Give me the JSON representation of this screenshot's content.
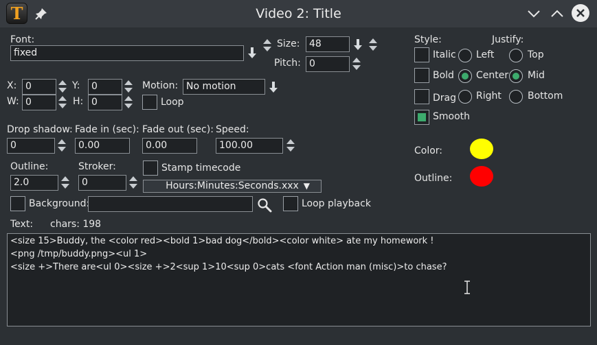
{
  "window": {
    "title": "Video 2: Title"
  },
  "icons": {
    "app": "title-app-icon",
    "pin": "pin-icon",
    "minimize": "chevron-down-icon",
    "maximize": "chevron-up-icon",
    "close": "close-icon"
  },
  "app_icon_letter": "T",
  "font": {
    "label": "Font:",
    "value": "fixed"
  },
  "size": {
    "label": "Size:",
    "value": "48"
  },
  "pitch": {
    "label": "Pitch:",
    "value": "0"
  },
  "position": {
    "x_label": "X:",
    "x_value": "0",
    "y_label": "Y:",
    "y_value": "0",
    "w_label": "W:",
    "w_value": "0",
    "h_label": "H:",
    "h_value": "0"
  },
  "motion": {
    "label": "Motion:",
    "value": "No motion",
    "loop_label": "Loop",
    "loop_checked": false
  },
  "drop_shadow": {
    "label": "Drop shadow:",
    "value": "0"
  },
  "fade_in": {
    "label": "Fade in (sec):",
    "value": "0.00"
  },
  "fade_out": {
    "label": "Fade out (sec):",
    "value": "0.00"
  },
  "speed": {
    "label": "Speed:",
    "value": "100.00"
  },
  "outline": {
    "label": "Outline:",
    "value": "2.0"
  },
  "stroker": {
    "label": "Stroker:",
    "value": "0"
  },
  "stamp_timecode": {
    "label": "Stamp timecode",
    "checked": false
  },
  "timecode_format": {
    "value": "Hours:Minutes:Seconds.xxx",
    "arrow": "▼"
  },
  "background": {
    "label": "Background:",
    "value": "",
    "checked": false
  },
  "loop_playback": {
    "label": "Loop playback",
    "checked": false
  },
  "style": {
    "label": "Style:",
    "italic": {
      "label": "Italic",
      "checked": false
    },
    "bold": {
      "label": "Bold",
      "checked": false
    },
    "drag": {
      "label": "Drag",
      "checked": false
    },
    "smooth": {
      "label": "Smooth",
      "checked": true
    }
  },
  "justify": {
    "label": "Justify:",
    "left": "Left",
    "center": "Center",
    "right": "Right",
    "top": "Top",
    "mid": "Mid",
    "bottom": "Bottom",
    "horizontal_selected": "Center",
    "vertical_selected": "Mid"
  },
  "color": {
    "label": "Color:",
    "value": "#ffff00"
  },
  "outline_color": {
    "label": "Outline:",
    "value": "#ff0000"
  },
  "text": {
    "label": "Text:",
    "chars": "chars: 198",
    "lines": [
      "<size 15>Buddy, the <color red><bold 1>bad dog</bold><color white> ate my homework !",
      "<png /tmp/buddy.png><ul 1>",
      "<size +>There are<ul 0><size +>2<sup 1>10<sup 0>cats <font Action man (misc)>to chase?"
    ]
  },
  "colors": {
    "accent": "#3daa6d",
    "background": "#2c3034",
    "field": "#1f2225",
    "titlebar": "#373b40"
  }
}
